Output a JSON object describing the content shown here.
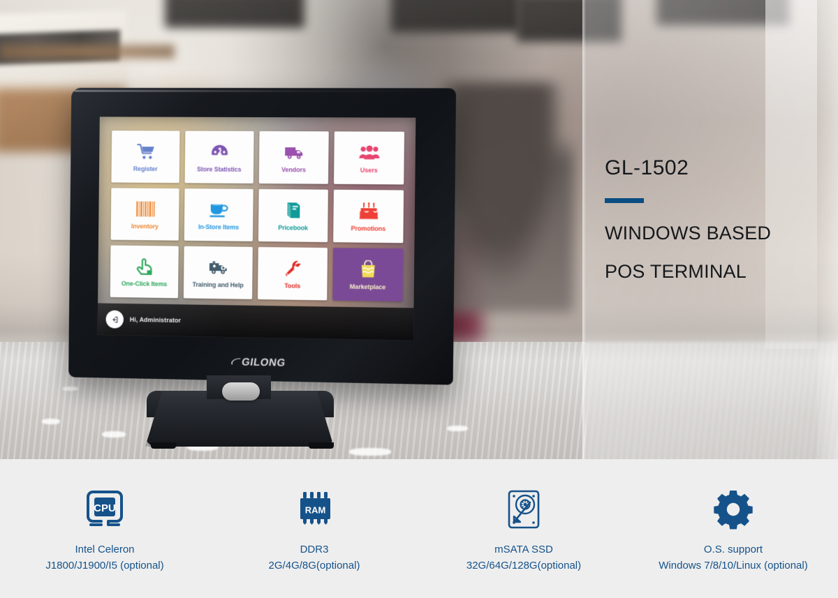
{
  "hero": {
    "model_code": "GL-1502",
    "headline_line1": "WINDOWS BASED",
    "headline_line2": "POS TERMINAL",
    "accent_color": "#0b4d82"
  },
  "device": {
    "brand": "GILONG",
    "taskbar": {
      "user_greeting": "Hi, Administrator",
      "user_icon": "logout-arrow-icon"
    },
    "screen": {
      "tiles": [
        {
          "label": "Register",
          "icon": "shopping-cart-icon",
          "color": "#4f6fc4",
          "style": "normal"
        },
        {
          "label": "Store Statistics",
          "icon": "speedometer-icon",
          "color": "#7a4fb0",
          "style": "normal"
        },
        {
          "label": "Vendors",
          "icon": "delivery-truck-icon",
          "color": "#9a4fae",
          "style": "normal"
        },
        {
          "label": "Users",
          "icon": "users-group-icon",
          "color": "#e8436f",
          "style": "normal"
        },
        {
          "label": "Inventory",
          "icon": "barcode-icon",
          "color": "#ef7f22",
          "style": "normal"
        },
        {
          "label": "In-Store Items",
          "icon": "coffee-cup-icon",
          "color": "#1b95e0",
          "style": "normal"
        },
        {
          "label": "Pricebook",
          "icon": "book-icon",
          "color": "#0f9b98",
          "style": "normal"
        },
        {
          "label": "Promotions",
          "icon": "birthday-cake-icon",
          "color": "#ee4036",
          "style": "normal"
        },
        {
          "label": "One-Click Items",
          "icon": "pointing-hand-icon",
          "color": "#23a455",
          "style": "normal"
        },
        {
          "label": "Training and Help",
          "icon": "ambulance-icon",
          "color": "#3f5a6b",
          "style": "normal"
        },
        {
          "label": "Tools",
          "icon": "wrench-icon",
          "color": "#e02b25",
          "style": "normal"
        },
        {
          "label": "Marketplace",
          "icon": "shopping-bag-icon",
          "color": "#f2dc55",
          "style": "highlight"
        }
      ]
    }
  },
  "specs": [
    {
      "icon": "cpu-chip-icon",
      "title": "Intel Celeron",
      "detail": "J1800/J1900/I5 (optional)"
    },
    {
      "icon": "ram-chip-icon",
      "title": "DDR3",
      "detail": "2G/4G/8G(optional)"
    },
    {
      "icon": "hard-drive-icon",
      "title": "mSATA SSD",
      "detail": "32G/64G/128G(optional)"
    },
    {
      "icon": "gear-icon",
      "title": "O.S. support",
      "detail": "Windows 7/8/10/Linux (optional)"
    }
  ]
}
